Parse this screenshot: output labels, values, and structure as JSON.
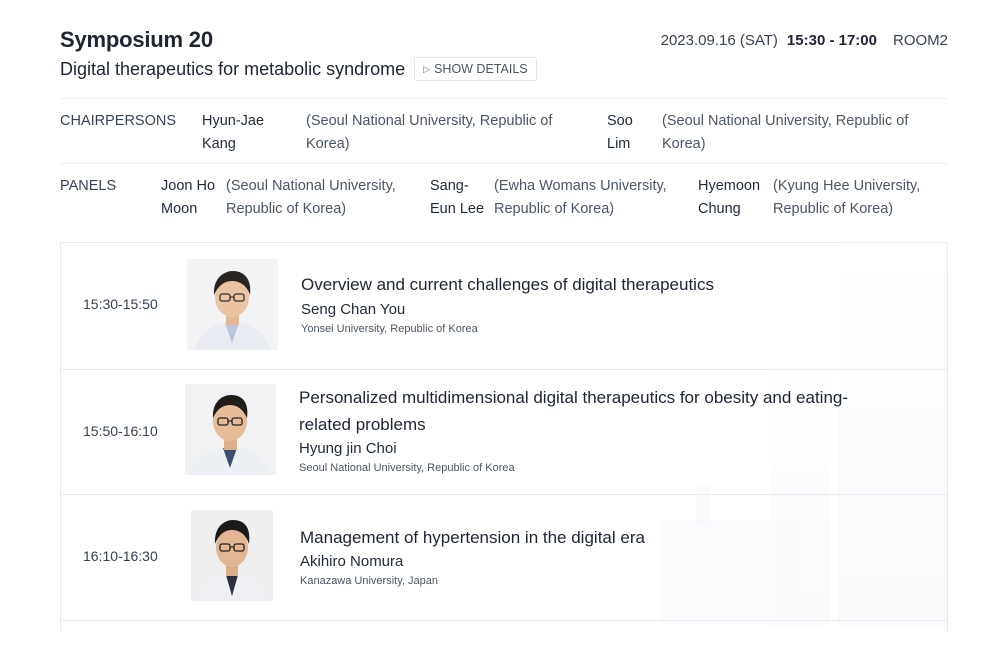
{
  "symposium": {
    "title": "Symposium 20",
    "subtitle": "Digital therapeutics for metabolic syndrome",
    "details_label": "SHOW DETAILS",
    "date": "2023.09.16 (SAT)",
    "time": "15:30 - 17:00",
    "room": "ROOM2"
  },
  "chairpersons": {
    "label": "CHAIRPERSONS",
    "people": [
      {
        "name_line1": "Hyun-Jae",
        "name_line2": "Kang",
        "aff_line1": "(Seoul National University, Republic of",
        "aff_line2": "Korea)"
      },
      {
        "name_line1": "Soo",
        "name_line2": "Lim",
        "aff_line1": "(Seoul National University, Republic of",
        "aff_line2": "Korea)"
      }
    ]
  },
  "panels": {
    "label": "PANELS",
    "people": [
      {
        "name_line1": "Joon Ho",
        "name_line2": "Moon",
        "aff_line1": "(Seoul National University,",
        "aff_line2": "Republic of Korea)"
      },
      {
        "name_line1": "Sang-",
        "name_line2": "Eun Lee",
        "aff_line1": "(Ewha Womans University,",
        "aff_line2": "Republic of Korea)"
      },
      {
        "name_line1": "Hyemoon",
        "name_line2": "Chung",
        "aff_line1": "(Kyung Hee University,",
        "aff_line2": "Republic of Korea)"
      }
    ]
  },
  "sessions": [
    {
      "time": "15:30-15:50",
      "title_line1": "Overview and current challenges of digital therapeutics",
      "title_line2": "",
      "speaker": "Seng Chan You",
      "affiliation": "Yonsei University, Republic of Korea"
    },
    {
      "time": "15:50-16:10",
      "title_line1": "Personalized multidimensional digital therapeutics for obesity and eating-",
      "title_line2": "related problems",
      "speaker": "Hyung jin Choi",
      "affiliation": "Seoul National University, Republic of Korea"
    },
    {
      "time": "16:10-16:30",
      "title_line1": "Management of hypertension in the digital era",
      "title_line2": "",
      "speaker": "Akihiro Nomura",
      "affiliation": "Kanazawa University, Japan"
    }
  ],
  "icons": {
    "details": "play-triangle-icon"
  }
}
